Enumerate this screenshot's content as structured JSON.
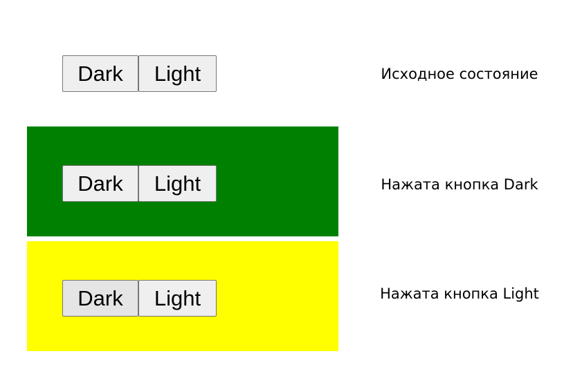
{
  "colors": {
    "dark_bg": "#008000",
    "light_bg": "#ffff00",
    "initial_bg": "#ffffff"
  },
  "states": [
    {
      "caption": "Исходное состояние",
      "dark_label": "Dark",
      "light_label": "Light",
      "pressed": null
    },
    {
      "caption": "Нажата кнопка Dark",
      "dark_label": "Dark",
      "light_label": "Light",
      "pressed": "Dark"
    },
    {
      "caption": "Нажата кнопка Light",
      "dark_label": "Dark",
      "light_label": "Light",
      "pressed": "Light"
    }
  ]
}
